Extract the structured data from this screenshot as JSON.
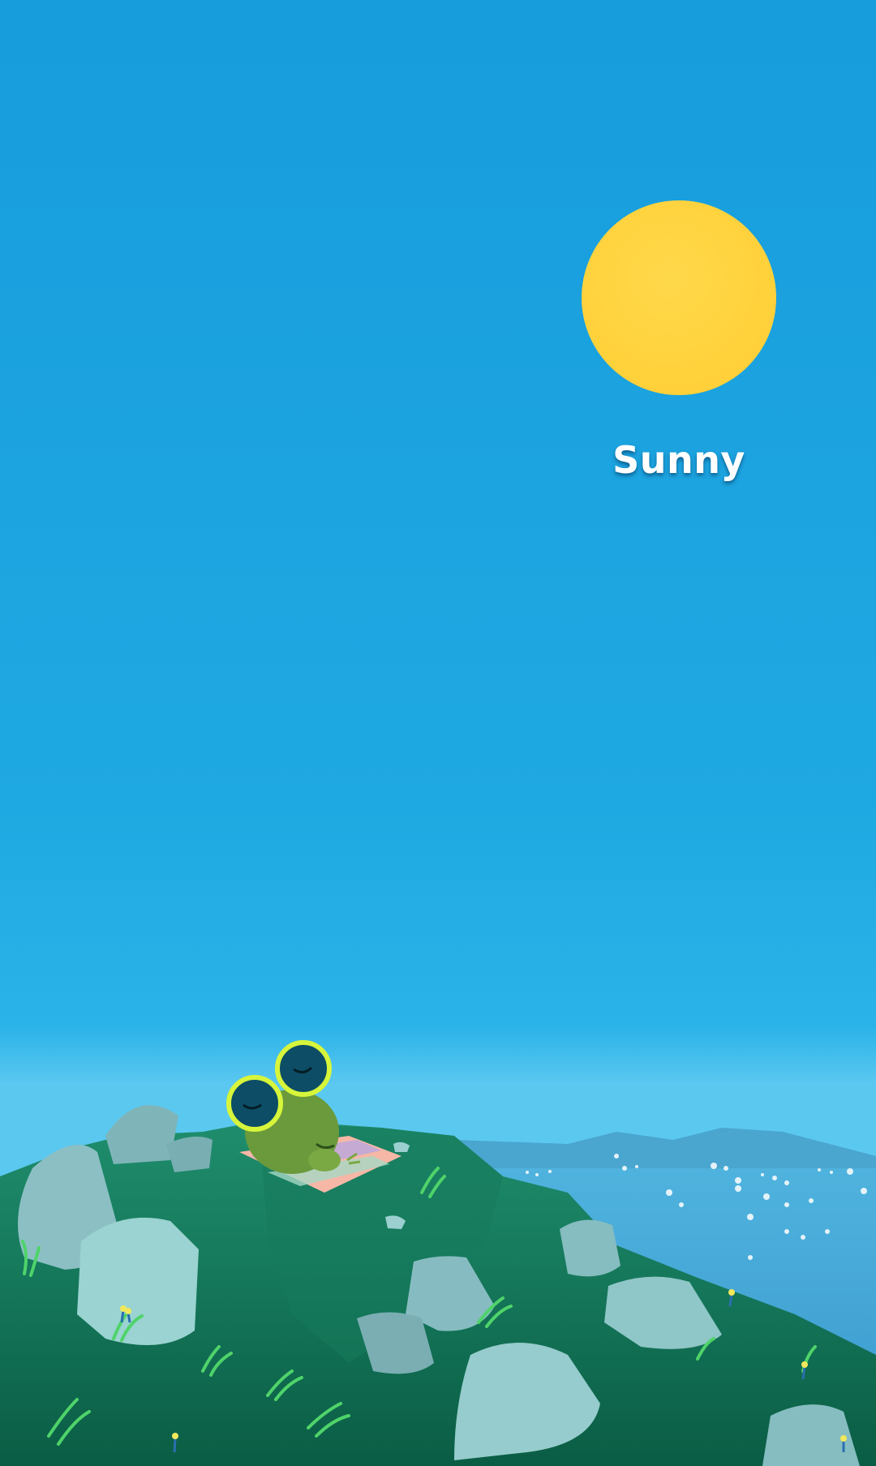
{
  "weather": {
    "condition_label": "Sunny",
    "sun_color": "#FFD23C"
  },
  "colors": {
    "sky_top": "#1A9FDE",
    "sky_mid": "#20ACE4",
    "sky_horizon": "#66CCF2",
    "hill_dark": "#0B6A4D",
    "hill_light": "#1E8E6C",
    "rock": "#8CC9CC",
    "sea": "#3A9FD0",
    "frog": "#6B9A3C",
    "sunglasses_frame": "#D7F53A",
    "sunglasses_lens": "#0D4D66"
  },
  "scene": {
    "character": "frog-with-sunglasses-icon",
    "background": "mountain-hilltop-landscape"
  }
}
